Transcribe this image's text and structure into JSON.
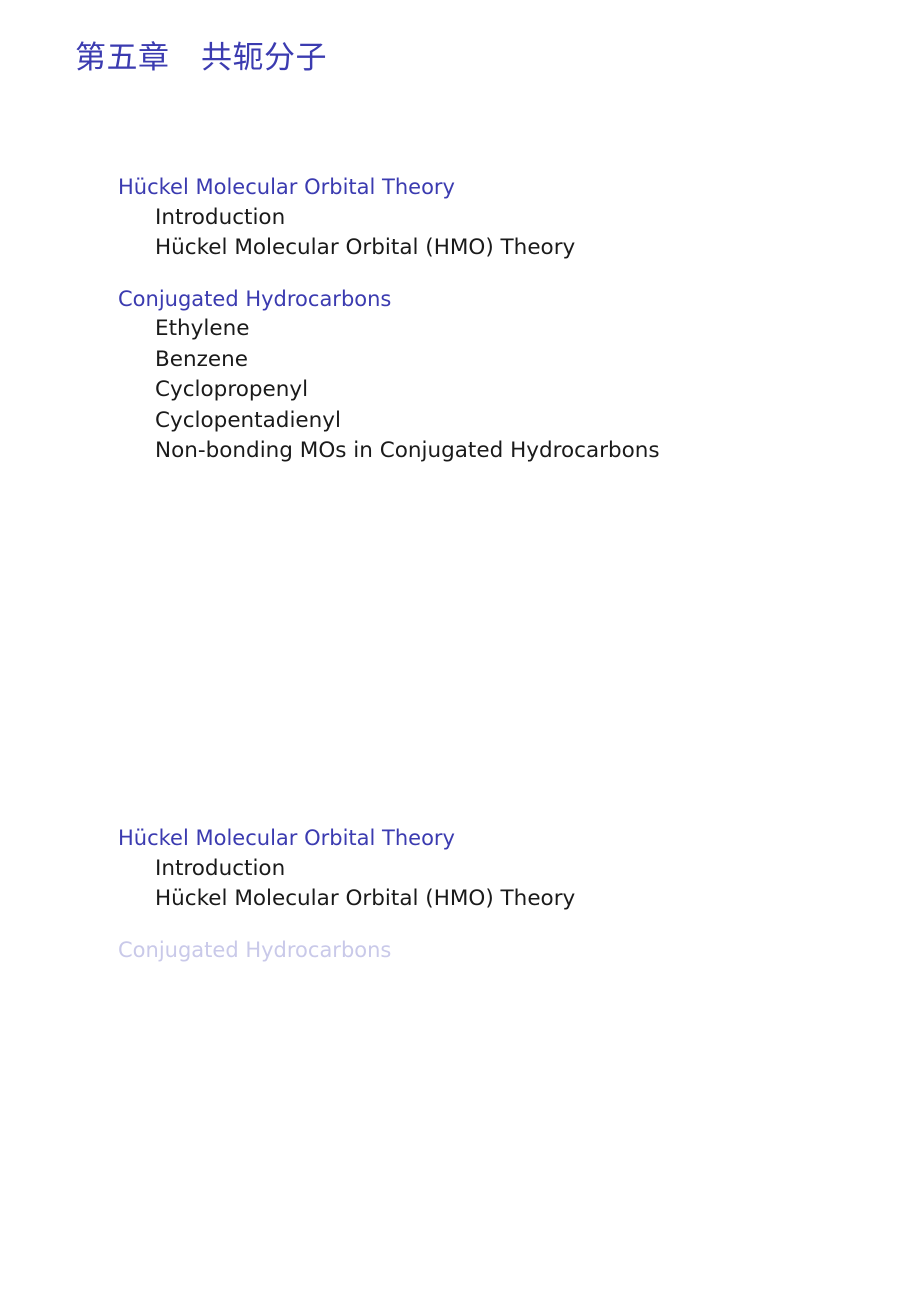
{
  "document": {
    "chapter_title": "第五章　共轭分子",
    "structure_color": "#3b3bb0",
    "body_color": "#1a1a1a",
    "dimmed_color": "#c9c9e9",
    "background_color": "#ffffff"
  },
  "outline_slides": [
    {
      "name": "outline-full",
      "sections": [
        {
          "title": "Hückel Molecular Orbital Theory",
          "dimmed": false,
          "subsections": [
            {
              "label": "Introduction",
              "dimmed": false
            },
            {
              "label": "Hückel Molecular Orbital (HMO) Theory",
              "dimmed": false
            }
          ]
        },
        {
          "title": "Conjugated Hydrocarbons",
          "dimmed": false,
          "subsections": [
            {
              "label": "Ethylene",
              "dimmed": false
            },
            {
              "label": "Benzene",
              "dimmed": false
            },
            {
              "label": "Cyclopropenyl",
              "dimmed": false
            },
            {
              "label": "Cyclopentadienyl",
              "dimmed": false
            },
            {
              "label": "Non-bonding MOs in Conjugated Hydrocarbons",
              "dimmed": false
            }
          ]
        }
      ]
    },
    {
      "name": "outline-current-section",
      "sections": [
        {
          "title": "Hückel Molecular Orbital Theory",
          "dimmed": false,
          "subsections": [
            {
              "label": "Introduction",
              "dimmed": false
            },
            {
              "label": "Hückel Molecular Orbital (HMO) Theory",
              "dimmed": false
            }
          ]
        },
        {
          "title": "Conjugated Hydrocarbons",
          "dimmed": true,
          "subsections": []
        }
      ]
    }
  ]
}
